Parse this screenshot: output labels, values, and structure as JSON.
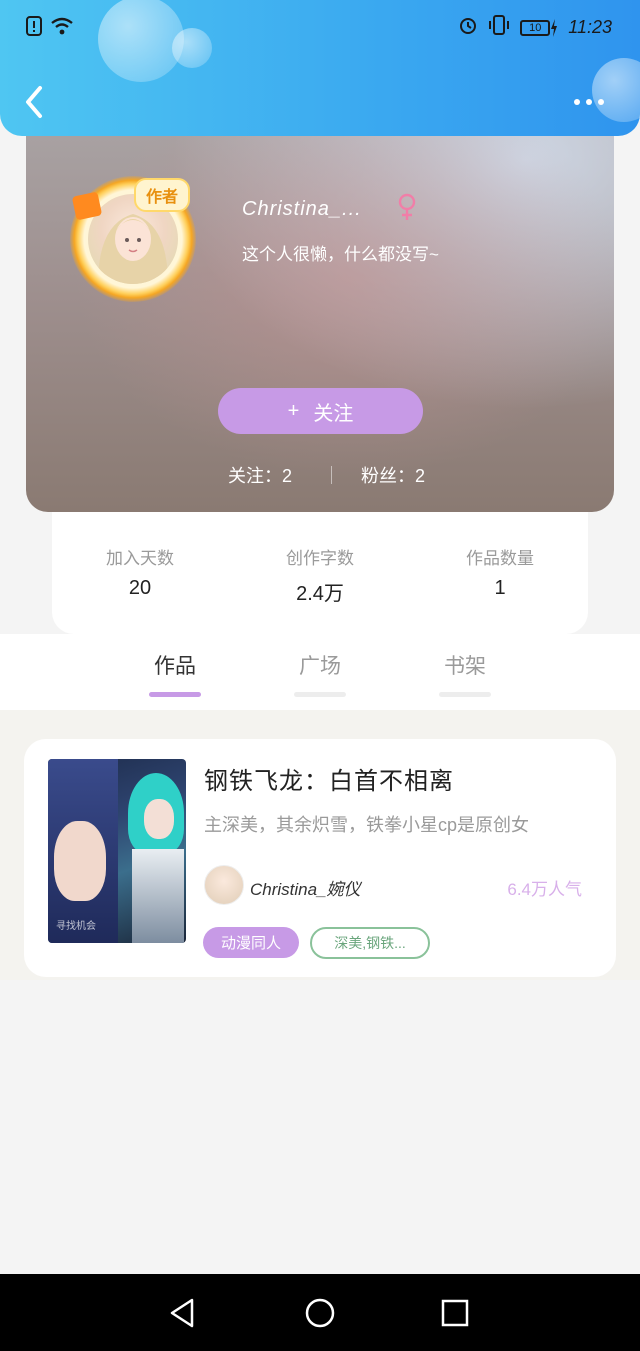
{
  "status_bar": {
    "time": "11:23",
    "battery": "10",
    "icons": [
      "sim-alert-icon",
      "wifi-icon",
      "alarm-icon",
      "vibrate-icon",
      "battery-icon",
      "charging-icon"
    ]
  },
  "header": {
    "back_icon": "back-chevron-icon",
    "more_icon": "more-dots-icon",
    "colors": {
      "start": "#4fc6f2",
      "end": "#2f94ee"
    }
  },
  "profile": {
    "author_badge": "作者",
    "username": "Christina_...",
    "gender_icon": "female-icon",
    "bio": "这个人很懒，什么都没写~",
    "follow_button": {
      "icon": "+",
      "label": "关注"
    },
    "following_label": "关注：2",
    "fans_label": "粉丝：2",
    "accent": "#c79ae6"
  },
  "stats": [
    {
      "label": "加入天数",
      "value": "20"
    },
    {
      "label": "创作字数",
      "value": "2.4万"
    },
    {
      "label": "作品数量",
      "value": "1"
    }
  ],
  "tabs": [
    {
      "label": "作品",
      "active": true
    },
    {
      "label": "广场",
      "active": false
    },
    {
      "label": "书架",
      "active": false
    }
  ],
  "work": {
    "title": "钢铁飞龙：白首不相离",
    "description": "主深美，其余炽雪，铁拳小星cp是原创女",
    "author": "Christina_婉仪",
    "popularity": "6.4万人气",
    "tags": [
      "动漫同人",
      "深美,钢铁..."
    ],
    "cover_watermark": "寻找机会"
  },
  "nav": {
    "back": "triangle-back-icon",
    "home": "circle-home-icon",
    "recents": "square-recents-icon"
  }
}
